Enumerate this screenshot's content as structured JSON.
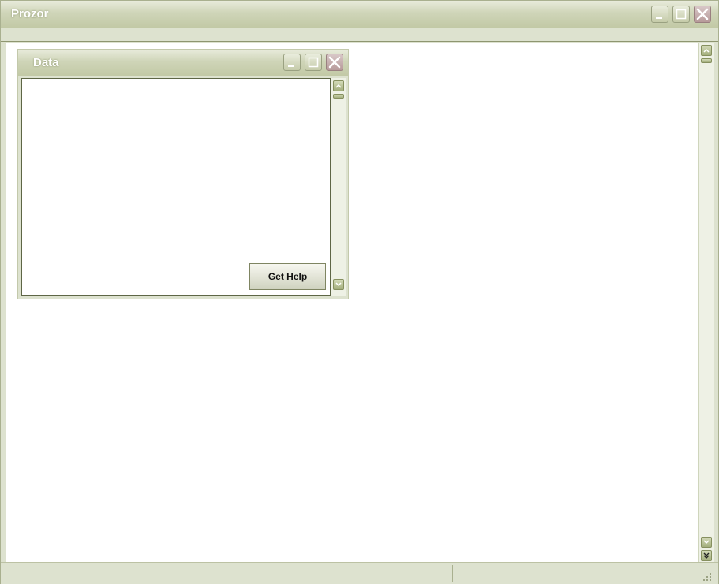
{
  "app": {
    "title": "Prozor"
  },
  "child_window": {
    "title": "Data",
    "get_help_label": "Get Help"
  },
  "statusbar": {
    "left_text": "",
    "right_text": ""
  },
  "colors": {
    "title_bar_gradient": [
      "#e8ebdb",
      "#c2c9a6"
    ],
    "frame_background": "#dde2cf",
    "close_button": "#b79a9a",
    "content_background": "#ffffff"
  },
  "icons": {
    "minimize": "minimize-icon",
    "maximize": "maximize-icon",
    "close": "close-icon",
    "scroll_up": "chevron-up-icon",
    "scroll_down": "chevron-down-icon",
    "scroll_end": "double-chevron-down-icon",
    "resize_grip": "resize-grip-icon"
  }
}
